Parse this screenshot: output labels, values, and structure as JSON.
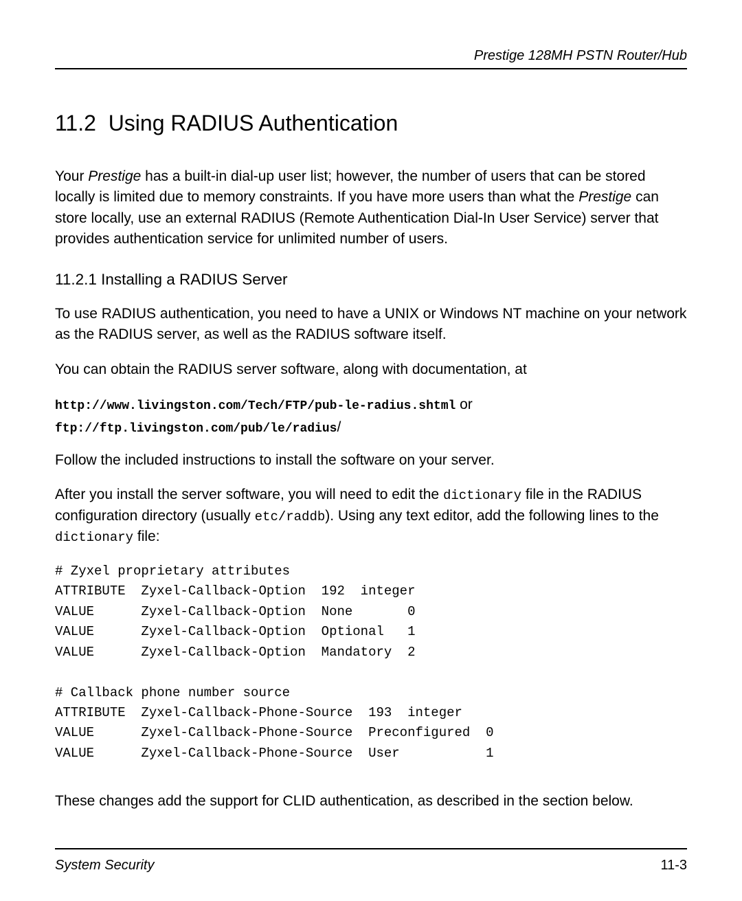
{
  "header": {
    "product": "Prestige 128MH  PSTN Router/Hub"
  },
  "section": {
    "number": "11.2",
    "title": "Using RADIUS  Authentication"
  },
  "para1": {
    "pre": "Your ",
    "product": "Prestige",
    "rest": " has a built-in dial-up user list; however, the number of users that can be stored locally is limited due to memory constraints.  If you have more users than what the ",
    "product2": "Prestige",
    "rest2": " can store locally, use an external RADIUS (Remote Authentication Dial-In User Service) server that provides authentication service for unlimited number of users."
  },
  "subsection": {
    "number": "11.2.1",
    "title": "Installing a RADIUS Server"
  },
  "para2": "To use RADIUS authentication, you need to have a UNIX or Windows NT machine on your network as the RADIUS server, as well as the RADIUS software itself.",
  "para3": "You can obtain the RADIUS server software, along with documentation, at",
  "urls": {
    "url1": "http://www.livingston.com/Tech/FTP/pub-le-radius.shtml",
    "or": " or",
    "url2": "ftp://ftp.livingston.com/pub/le/radius",
    "slash": "/"
  },
  "para4": "Follow the included instructions to install the software on your server.",
  "para5": {
    "a": "After you install the server software, you will need to edit the ",
    "dict1": "dictionary",
    "b": " file in the RADIUS configuration directory (usually ",
    "path": "etc/raddb",
    "c": "). Using any text editor, add the following lines to the ",
    "dict2": "dictionary",
    "d": " file:"
  },
  "code": "# Zyxel proprietary attributes\nATTRIBUTE  Zyxel-Callback-Option  192  integer\nVALUE      Zyxel-Callback-Option  None       0\nVALUE      Zyxel-Callback-Option  Optional   1\nVALUE      Zyxel-Callback-Option  Mandatory  2\n\n# Callback phone number source\nATTRIBUTE  Zyxel-Callback-Phone-Source  193  integer\nVALUE      Zyxel-Callback-Phone-Source  Preconfigured  0\nVALUE      Zyxel-Callback-Phone-Source  User           1",
  "para6": "These changes add the support for CLID authentication, as described in the section below.",
  "footer": {
    "left": "System Security",
    "right": "11-3"
  }
}
